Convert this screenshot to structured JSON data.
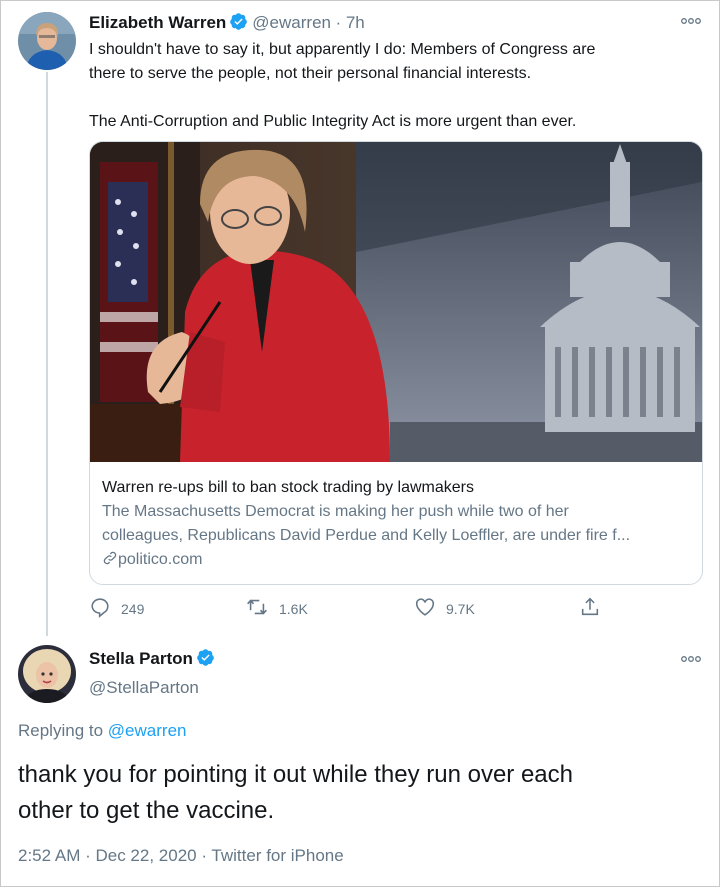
{
  "tweet1": {
    "author_name": "Elizabeth Warren",
    "handle": "@ewarren",
    "time": "· 7h",
    "text_line1": "I shouldn't have to say it, but apparently I do: Members of Congress are",
    "text_line2": "there to serve the people, not their personal financial interests.",
    "text_line3": "The Anti-Corruption and Public Integrity Act is more urgent than ever.",
    "card": {
      "title": "Warren re-ups bill to ban stock trading by lawmakers",
      "desc_line1": "The Massachusetts Democrat is making her push while two of her",
      "desc_line2": "colleagues, Republicans David Perdue and Kelly Loeffler, are under fire f...",
      "domain": "politico.com"
    },
    "actions": {
      "replies": "249",
      "retweets": "1.6K",
      "likes": "9.7K"
    }
  },
  "tweet2": {
    "author_name": "Stella Parton",
    "handle": "@StellaParton",
    "replying_prefix": "Replying to",
    "replying_to": "@ewarren",
    "text_line1": "thank you for pointing it out while they run over each",
    "text_line2": "other to get the vaccine.",
    "meta": "2:52 AM · Dec 22, 2020 · Twitter for iPhone"
  },
  "colors": {
    "accent": "#1da1f2",
    "muted": "#657786",
    "text": "#14171a",
    "border": "#cfd9de",
    "jacket": "#c8232c"
  },
  "icons": [
    "verified-badge-icon",
    "more-options-icon",
    "reply-icon",
    "retweet-icon",
    "like-icon",
    "share-icon",
    "link-icon"
  ]
}
